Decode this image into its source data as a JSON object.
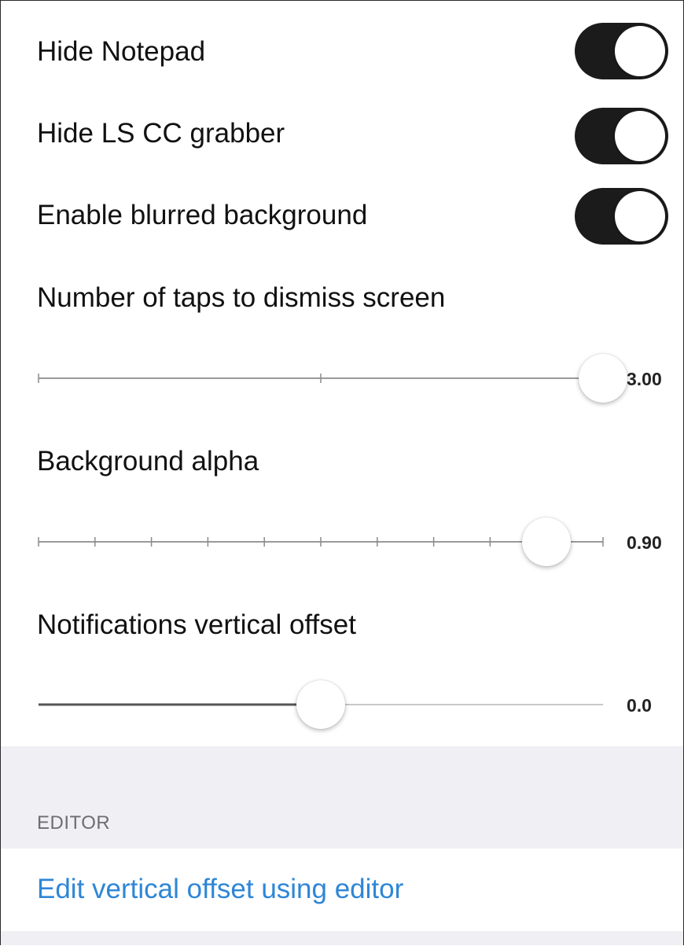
{
  "toggles": [
    {
      "label": "Hide Notepad",
      "on": true
    },
    {
      "label": "Hide LS CC grabber",
      "on": true
    },
    {
      "label": "Enable blurred background",
      "on": true
    }
  ],
  "sliders": [
    {
      "label": "Number of taps to dismiss screen",
      "value_text": "3.00",
      "value": 3.0,
      "min": 1,
      "max": 3,
      "ticks": 3,
      "filled": false
    },
    {
      "label": "Background alpha",
      "value_text": "0.90",
      "value": 0.9,
      "min": 0,
      "max": 1,
      "ticks": 11,
      "filled": false
    },
    {
      "label": "Notifications vertical offset",
      "value_text": "0.0",
      "value": 0.0,
      "min": -1,
      "max": 1,
      "ticks": 0,
      "filled": true
    }
  ],
  "editor_section": {
    "header": "EDITOR",
    "link": "Edit vertical offset using editor"
  },
  "colors": {
    "toggle_on": "#1b1b1b",
    "link": "#2e86d6",
    "group_background": "#efeff4"
  }
}
